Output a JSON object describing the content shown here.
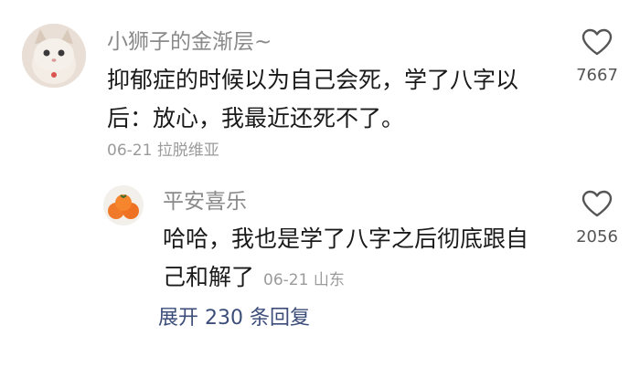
{
  "comment": {
    "username": "小狮子的金渐层~",
    "text_line1": "抑郁症的时候以为自己会死，学了八字以",
    "text_line2": "后：放心，我最近还死不了。",
    "date": "06-21",
    "location": "拉脱维亚",
    "like_count": "7667"
  },
  "reply": {
    "username": "平安喜乐",
    "text_line1": "哈哈，我也是学了八字之后彻底跟自",
    "text_line2": "己和解了",
    "date": "06-21",
    "location": "山东",
    "like_count": "2056"
  },
  "expand_replies": {
    "label": "展开 230 条回复"
  },
  "icons": {
    "like": "heart-outline-icon"
  },
  "colors": {
    "username": "#8a8a8a",
    "text": "#1a1a1a",
    "meta": "#9b9b9b",
    "link": "#3b4d78"
  }
}
